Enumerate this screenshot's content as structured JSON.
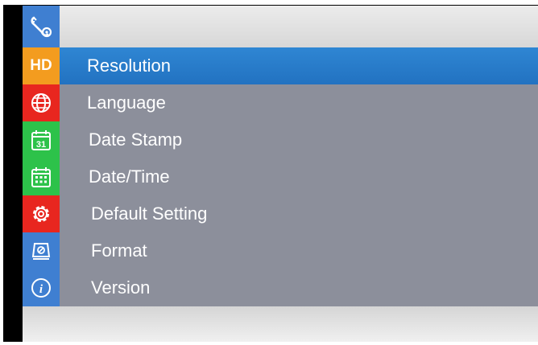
{
  "header": {
    "icon": "wrench-gear-icon"
  },
  "menu": {
    "items": [
      {
        "label": "Resolution",
        "icon": "hd-icon",
        "icon_text": "HD",
        "icon_bg": "#f39c1f",
        "selected": true
      },
      {
        "label": "Language",
        "icon": "globe-icon",
        "icon_bg": "#e8261f",
        "selected": false
      },
      {
        "label": "Date Stamp",
        "icon": "calendar-31-icon",
        "icon_text": "31",
        "icon_bg": "#2dc24a",
        "selected": false
      },
      {
        "label": "Date/Time",
        "icon": "calendar-grid-icon",
        "icon_bg": "#2dc24a",
        "selected": false
      },
      {
        "label": "Default Setting",
        "icon": "gear-icon",
        "icon_bg": "#e8261f",
        "selected": false
      },
      {
        "label": "Format",
        "icon": "format-disk-icon",
        "icon_bg": "#3f7fd1",
        "selected": false
      },
      {
        "label": "Version",
        "icon": "info-icon",
        "icon_text": "i",
        "icon_bg": "#3f7fd1",
        "selected": false
      }
    ]
  },
  "colors": {
    "selected_row": "#2a7cc9",
    "menu_bg": "#8c8f9b",
    "text": "#ffffff"
  }
}
